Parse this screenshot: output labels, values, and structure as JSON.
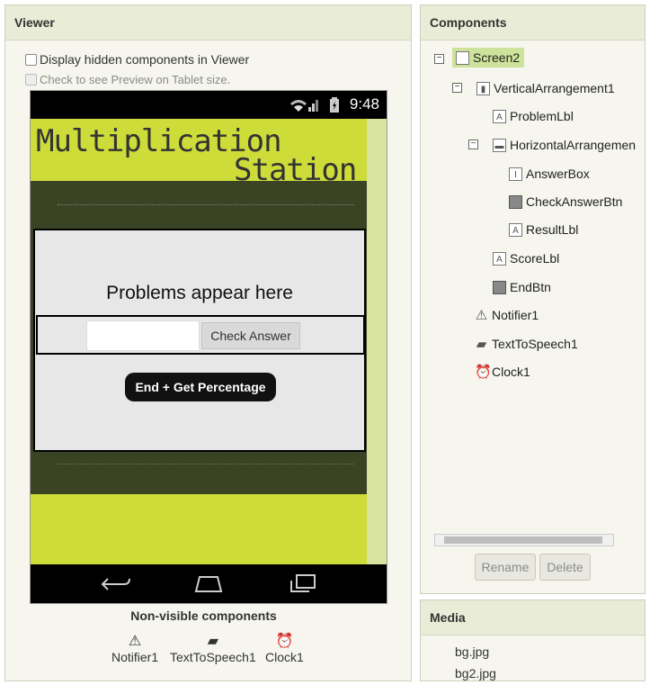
{
  "viewer": {
    "title": "Viewer",
    "display_hidden_label": "Display hidden components in Viewer",
    "tablet_preview_label": "Check to see Preview on Tablet size.",
    "phone": {
      "clock": "9:48",
      "title_line1": "Multiplication",
      "title_line2": "Station",
      "problem_label": "Problems appear here",
      "check_answer_label": "Check Answer",
      "end_button_label": "End + Get Percentage",
      "answerbox_value": ""
    },
    "non_visible_title": "Non-visible components",
    "non_visible": [
      {
        "label": "Notifier1",
        "icon": "warning-icon"
      },
      {
        "label": "TextToSpeech1",
        "icon": "speech-icon"
      },
      {
        "label": "Clock1",
        "icon": "clock-icon"
      }
    ]
  },
  "components": {
    "title": "Components",
    "tree": [
      {
        "label": "Screen2",
        "icon": "screen-icon",
        "selected": true
      },
      {
        "label": "VerticalArrangement1",
        "icon": "vertical-arrangement-icon"
      },
      {
        "label": "ProblemLbl",
        "icon": "label-icon"
      },
      {
        "label": "HorizontalArrangemen",
        "icon": "horizontal-arrangement-icon"
      },
      {
        "label": "AnswerBox",
        "icon": "textbox-icon"
      },
      {
        "label": "CheckAnswerBtn",
        "icon": "button-icon"
      },
      {
        "label": "ResultLbl",
        "icon": "label-icon"
      },
      {
        "label": "ScoreLbl",
        "icon": "label-icon"
      },
      {
        "label": "EndBtn",
        "icon": "button-icon"
      },
      {
        "label": "Notifier1",
        "icon": "warning-icon"
      },
      {
        "label": "TextToSpeech1",
        "icon": "speech-icon"
      },
      {
        "label": "Clock1",
        "icon": "clock-icon"
      }
    ],
    "rename_label": "Rename",
    "delete_label": "Delete"
  },
  "media": {
    "title": "Media",
    "files": [
      "bg.jpg",
      "bg2.jpg"
    ]
  },
  "colors": {
    "screen_bg": "#cddc39",
    "dark_band": "#3b4325",
    "selected_row": "#cde29a"
  }
}
